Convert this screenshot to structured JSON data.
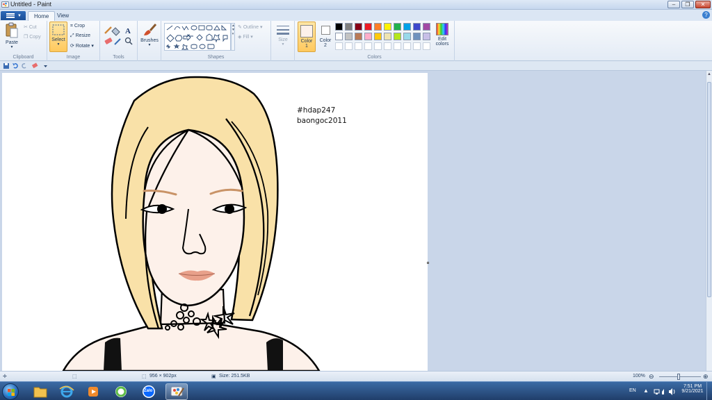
{
  "window": {
    "title": "Untitled - Paint",
    "minimize_icon": "minimize-icon",
    "maximize_icon": "restore-icon",
    "close_icon": "close-icon"
  },
  "tabs": [
    {
      "label": "Home",
      "active": true
    },
    {
      "label": "View",
      "active": false
    }
  ],
  "ribbon": {
    "clipboard": {
      "label": "Clipboard",
      "paste": "Paste",
      "cut": "Cut",
      "copy": "Copy"
    },
    "image": {
      "label": "Image",
      "select": "Select",
      "crop": "Crop",
      "resize": "Resize",
      "rotate": "Rotate"
    },
    "tools": {
      "label": "Tools"
    },
    "brushes": {
      "label": "Brushes"
    },
    "shapes": {
      "label": "Shapes",
      "outline": "Outline",
      "fill": "Fill"
    },
    "size": {
      "label": "Size"
    },
    "colors": {
      "label": "Colors",
      "color1": "Color",
      "color1_num": "1",
      "color2": "Color",
      "color2_num": "2",
      "edit_colors_1": "Edit",
      "edit_colors_2": "colors",
      "palette_row1": [
        "#000000",
        "#7f7f7f",
        "#880015",
        "#ed1c24",
        "#ff7f27",
        "#fff200",
        "#22b14c",
        "#00a2e8",
        "#3f48cc",
        "#a349a4"
      ],
      "palette_row2": [
        "#ffffff",
        "#c3c3c3",
        "#b97a57",
        "#ffaec9",
        "#ffc90e",
        "#efe4b0",
        "#b5e61d",
        "#99d9ea",
        "#7092be",
        "#c8bfe7"
      ],
      "palette_row3": [
        "#ffffff",
        "#ffffff",
        "#ffffff",
        "#ffffff",
        "#ffffff",
        "#ffffff",
        "#ffffff",
        "#ffffff",
        "#ffffff",
        "#ffffff"
      ]
    }
  },
  "canvas": {
    "text_line1": "#hdap247",
    "text_line2": "baongoc2011",
    "hair_color": "#f9e1a8",
    "skin_color": "#fdf1ea",
    "lip_color": "#e8a08a",
    "brow_color": "#c99367"
  },
  "status": {
    "dimensions": "956 × 902px",
    "size": "Size: 251.5KB",
    "zoom": "100%"
  },
  "taskbar": {
    "lang": "EN",
    "time": "7:51 PM",
    "date": "9/21/2021",
    "zalo": "Zalo"
  }
}
